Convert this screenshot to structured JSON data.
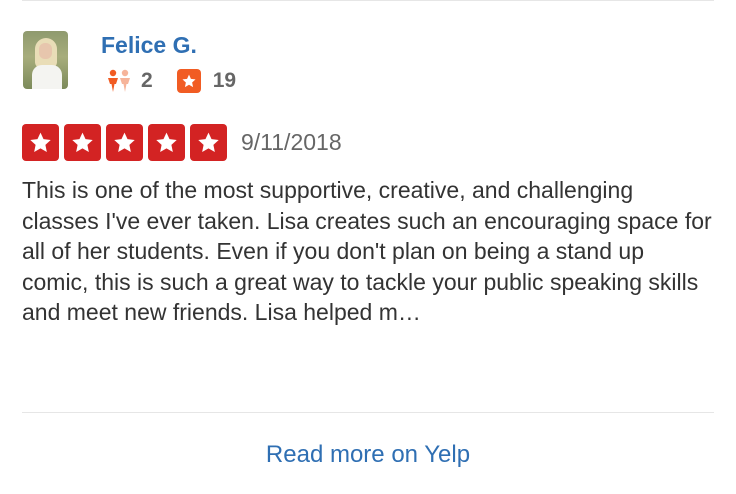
{
  "reviewer": {
    "name": "Felice G.",
    "friends_count": "2",
    "reviews_count": "19"
  },
  "review": {
    "rating": 5,
    "date": "9/11/2018",
    "text": "This is one of the most supportive, creative, and challenging classes I've ever taken. Lisa creates such an encouraging space for all of her students. Even if you don't plan on being a stand up comic, this is such a great way to tackle your public speaking skills and meet new friends. Lisa helped m…"
  },
  "footer": {
    "read_more_label": "Read more on Yelp"
  },
  "colors": {
    "link_blue": "#2f6fb3",
    "star_red": "#d32323",
    "review_icon_orange": "#f15c23",
    "friends_icon_orange": "#f15c23"
  }
}
